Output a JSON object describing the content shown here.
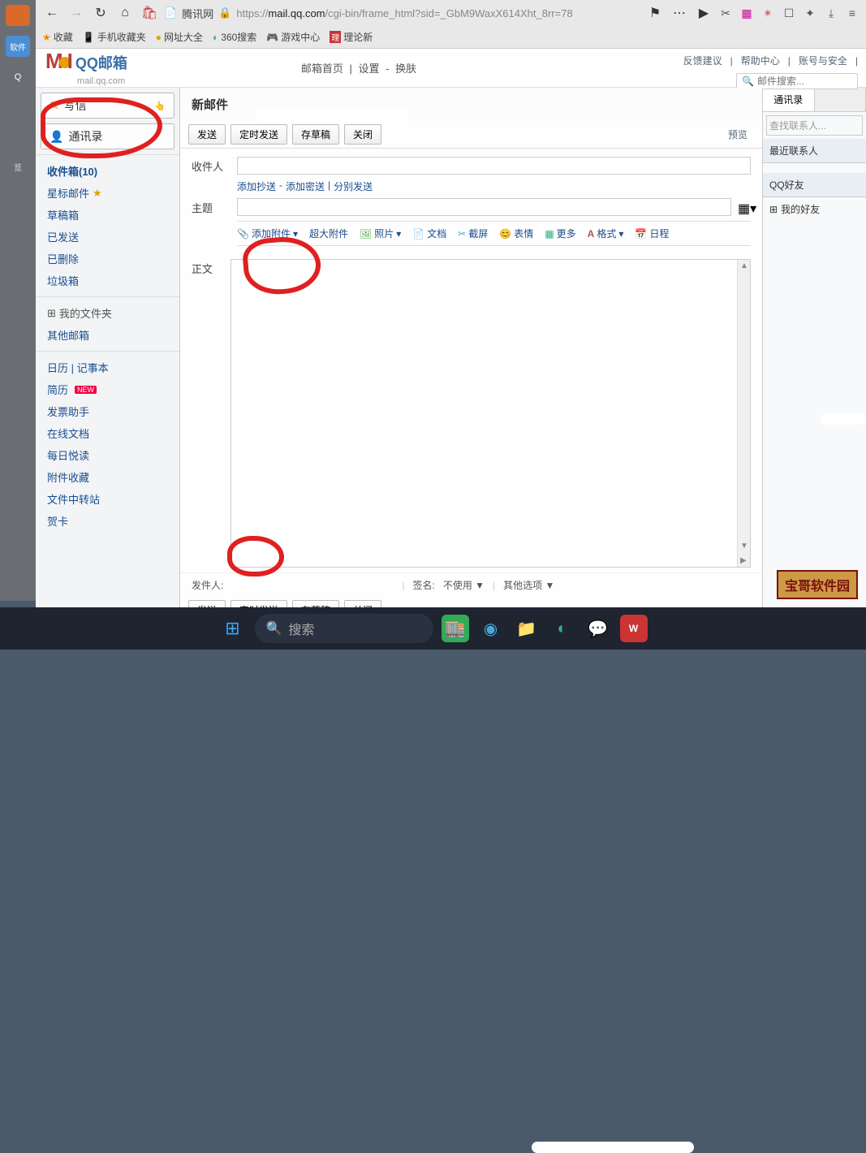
{
  "browser": {
    "tab_title": "腾讯网",
    "url_scheme": "https://",
    "url_host": "mail.qq.com",
    "url_path": "/cgi-bin/frame_html?sid=_GbM9WaxX614Xht_8rr=78",
    "bookmarks": {
      "fav_label": "收藏",
      "phone_fav": "手机收藏夹",
      "site_nav": "网址大全",
      "search360": "360搜索",
      "game_center": "游戏中心",
      "theory": "理论新"
    }
  },
  "header": {
    "logo_m": "M",
    "logo_brand": "QQ邮箱",
    "logo_domain": "mail.qq.com",
    "nav_home": "邮箱首页",
    "nav_settings": "设置",
    "nav_skin": "换肤",
    "feedback": "反馈建议",
    "help": "帮助中心",
    "account_security": "账号与安全",
    "search_placeholder": "邮件搜索..."
  },
  "sidebar": {
    "compose": "写信",
    "contacts": "通讯录",
    "inbox": "收件箱(10)",
    "starred": "星标邮件",
    "drafts": "草稿箱",
    "sent": "已发送",
    "deleted": "已删除",
    "trash": "垃圾箱",
    "my_folders": "我的文件夹",
    "other_mail": "其他邮箱",
    "calendar_notes": "日历 | 记事本",
    "resume": "简历",
    "new_badge": "NEW",
    "invoice": "发票助手",
    "online_docs": "在线文档",
    "daily_read": "每日悦读",
    "attachments": "附件收藏",
    "file_station": "文件中转站",
    "greeting_cards": "贺卡"
  },
  "compose": {
    "title": "新邮件",
    "send": "发送",
    "timed_send": "定时发送",
    "save_draft": "存草稿",
    "close": "关闭",
    "preview": "预览",
    "to_label": "收件人",
    "add_cc": "添加抄送",
    "add_bcc": "添加密送",
    "separate_send": "分别发送",
    "subject_label": "主题",
    "add_attachment": "添加附件",
    "big_attachment": "超大附件",
    "photo": "照片",
    "doc": "文档",
    "screenshot": "截屏",
    "emoji": "表情",
    "more": "更多",
    "format": "格式",
    "schedule": "日程",
    "body_label": "正文",
    "from_label": "发件人:",
    "signature_label": "签名:",
    "signature_value": "不使用",
    "other_options": "其他选项"
  },
  "rightpanel": {
    "tab_contacts": "通讯录",
    "search_placeholder": "查找联系人...",
    "recent_contacts": "最近联系人",
    "qq_friends": "QQ好友",
    "my_friends": "我的好友"
  },
  "taskbar": {
    "search_placeholder": "搜索"
  },
  "watermark": "宝哥软件园"
}
